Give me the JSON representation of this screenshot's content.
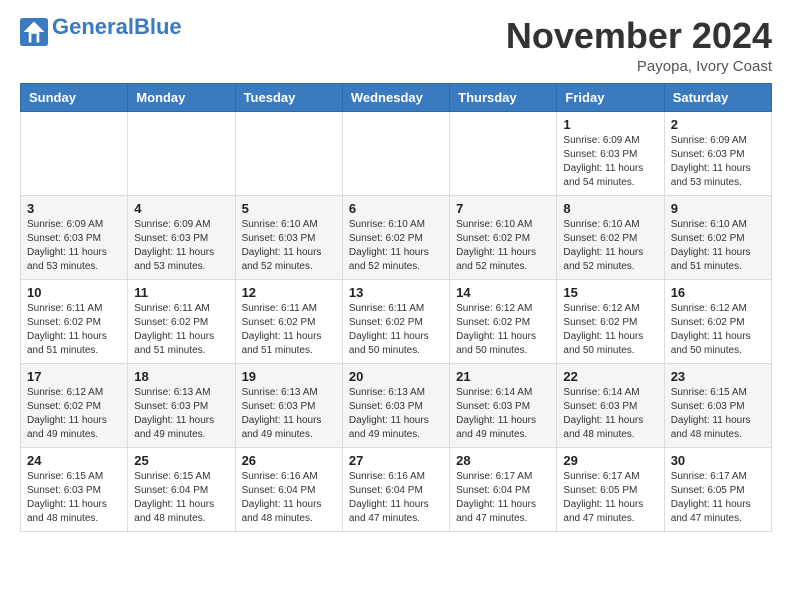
{
  "header": {
    "logo_general": "General",
    "logo_blue": "Blue",
    "month_title": "November 2024",
    "location": "Payopa, Ivory Coast"
  },
  "weekdays": [
    "Sunday",
    "Monday",
    "Tuesday",
    "Wednesday",
    "Thursday",
    "Friday",
    "Saturday"
  ],
  "weeks": [
    [
      {
        "day": "",
        "info": ""
      },
      {
        "day": "",
        "info": ""
      },
      {
        "day": "",
        "info": ""
      },
      {
        "day": "",
        "info": ""
      },
      {
        "day": "",
        "info": ""
      },
      {
        "day": "1",
        "info": "Sunrise: 6:09 AM\nSunset: 6:03 PM\nDaylight: 11 hours\nand 54 minutes."
      },
      {
        "day": "2",
        "info": "Sunrise: 6:09 AM\nSunset: 6:03 PM\nDaylight: 11 hours\nand 53 minutes."
      }
    ],
    [
      {
        "day": "3",
        "info": "Sunrise: 6:09 AM\nSunset: 6:03 PM\nDaylight: 11 hours\nand 53 minutes."
      },
      {
        "day": "4",
        "info": "Sunrise: 6:09 AM\nSunset: 6:03 PM\nDaylight: 11 hours\nand 53 minutes."
      },
      {
        "day": "5",
        "info": "Sunrise: 6:10 AM\nSunset: 6:03 PM\nDaylight: 11 hours\nand 52 minutes."
      },
      {
        "day": "6",
        "info": "Sunrise: 6:10 AM\nSunset: 6:02 PM\nDaylight: 11 hours\nand 52 minutes."
      },
      {
        "day": "7",
        "info": "Sunrise: 6:10 AM\nSunset: 6:02 PM\nDaylight: 11 hours\nand 52 minutes."
      },
      {
        "day": "8",
        "info": "Sunrise: 6:10 AM\nSunset: 6:02 PM\nDaylight: 11 hours\nand 52 minutes."
      },
      {
        "day": "9",
        "info": "Sunrise: 6:10 AM\nSunset: 6:02 PM\nDaylight: 11 hours\nand 51 minutes."
      }
    ],
    [
      {
        "day": "10",
        "info": "Sunrise: 6:11 AM\nSunset: 6:02 PM\nDaylight: 11 hours\nand 51 minutes."
      },
      {
        "day": "11",
        "info": "Sunrise: 6:11 AM\nSunset: 6:02 PM\nDaylight: 11 hours\nand 51 minutes."
      },
      {
        "day": "12",
        "info": "Sunrise: 6:11 AM\nSunset: 6:02 PM\nDaylight: 11 hours\nand 51 minutes."
      },
      {
        "day": "13",
        "info": "Sunrise: 6:11 AM\nSunset: 6:02 PM\nDaylight: 11 hours\nand 50 minutes."
      },
      {
        "day": "14",
        "info": "Sunrise: 6:12 AM\nSunset: 6:02 PM\nDaylight: 11 hours\nand 50 minutes."
      },
      {
        "day": "15",
        "info": "Sunrise: 6:12 AM\nSunset: 6:02 PM\nDaylight: 11 hours\nand 50 minutes."
      },
      {
        "day": "16",
        "info": "Sunrise: 6:12 AM\nSunset: 6:02 PM\nDaylight: 11 hours\nand 50 minutes."
      }
    ],
    [
      {
        "day": "17",
        "info": "Sunrise: 6:12 AM\nSunset: 6:02 PM\nDaylight: 11 hours\nand 49 minutes."
      },
      {
        "day": "18",
        "info": "Sunrise: 6:13 AM\nSunset: 6:03 PM\nDaylight: 11 hours\nand 49 minutes."
      },
      {
        "day": "19",
        "info": "Sunrise: 6:13 AM\nSunset: 6:03 PM\nDaylight: 11 hours\nand 49 minutes."
      },
      {
        "day": "20",
        "info": "Sunrise: 6:13 AM\nSunset: 6:03 PM\nDaylight: 11 hours\nand 49 minutes."
      },
      {
        "day": "21",
        "info": "Sunrise: 6:14 AM\nSunset: 6:03 PM\nDaylight: 11 hours\nand 49 minutes."
      },
      {
        "day": "22",
        "info": "Sunrise: 6:14 AM\nSunset: 6:03 PM\nDaylight: 11 hours\nand 48 minutes."
      },
      {
        "day": "23",
        "info": "Sunrise: 6:15 AM\nSunset: 6:03 PM\nDaylight: 11 hours\nand 48 minutes."
      }
    ],
    [
      {
        "day": "24",
        "info": "Sunrise: 6:15 AM\nSunset: 6:03 PM\nDaylight: 11 hours\nand 48 minutes."
      },
      {
        "day": "25",
        "info": "Sunrise: 6:15 AM\nSunset: 6:04 PM\nDaylight: 11 hours\nand 48 minutes."
      },
      {
        "day": "26",
        "info": "Sunrise: 6:16 AM\nSunset: 6:04 PM\nDaylight: 11 hours\nand 48 minutes."
      },
      {
        "day": "27",
        "info": "Sunrise: 6:16 AM\nSunset: 6:04 PM\nDaylight: 11 hours\nand 47 minutes."
      },
      {
        "day": "28",
        "info": "Sunrise: 6:17 AM\nSunset: 6:04 PM\nDaylight: 11 hours\nand 47 minutes."
      },
      {
        "day": "29",
        "info": "Sunrise: 6:17 AM\nSunset: 6:05 PM\nDaylight: 11 hours\nand 47 minutes."
      },
      {
        "day": "30",
        "info": "Sunrise: 6:17 AM\nSunset: 6:05 PM\nDaylight: 11 hours\nand 47 minutes."
      }
    ]
  ]
}
